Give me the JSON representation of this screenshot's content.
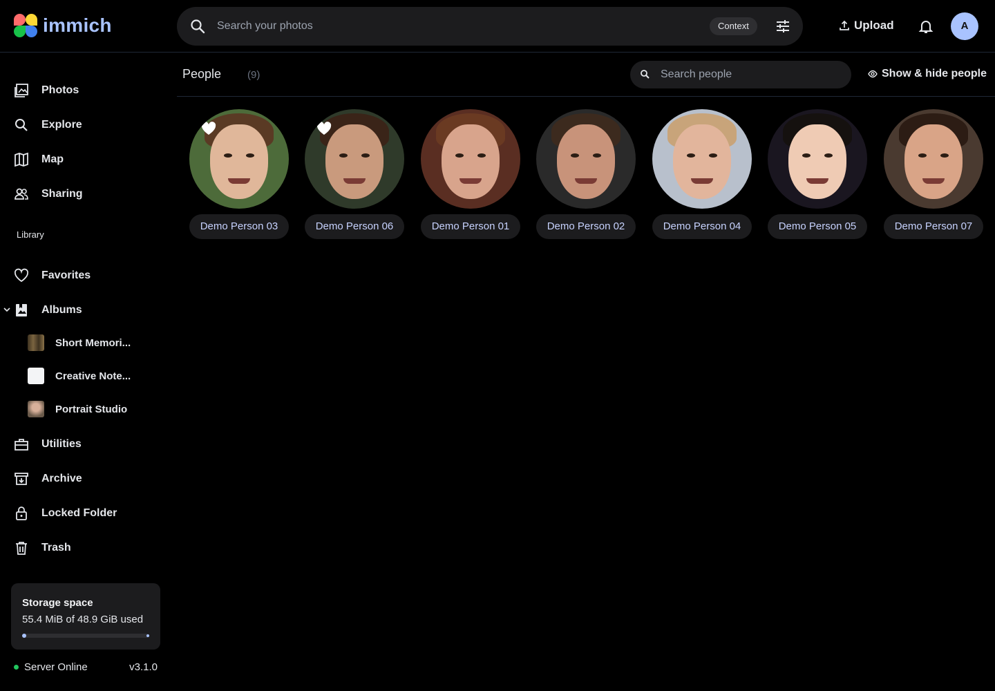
{
  "app": {
    "name": "immich"
  },
  "search": {
    "placeholder": "Search your photos",
    "context_label": "Context"
  },
  "header": {
    "upload_label": "Upload",
    "avatar_initial": "A"
  },
  "sidebar": {
    "nav": [
      {
        "label": "Photos",
        "icon": "photos-icon"
      },
      {
        "label": "Explore",
        "icon": "search-icon"
      },
      {
        "label": "Map",
        "icon": "map-icon"
      },
      {
        "label": "Sharing",
        "icon": "people-icon"
      }
    ],
    "library_label": "Library",
    "library": [
      {
        "label": "Favorites",
        "icon": "heart-icon"
      },
      {
        "label": "Albums",
        "icon": "album-icon"
      }
    ],
    "albums": [
      {
        "label": "Short Memori...",
        "thumb_color": "#6b5a3a"
      },
      {
        "label": "Creative Note...",
        "thumb_color": "#f3f4f6"
      },
      {
        "label": "Portrait Studio",
        "thumb_color": "#9a8a7a"
      }
    ],
    "more": [
      {
        "label": "Utilities",
        "icon": "toolbox-icon"
      },
      {
        "label": "Archive",
        "icon": "archive-icon"
      },
      {
        "label": "Locked Folder",
        "icon": "lock-icon"
      },
      {
        "label": "Trash",
        "icon": "trash-icon"
      }
    ],
    "storage": {
      "title": "Storage space",
      "used_text": "55.4 MiB of 48.9 GiB used",
      "used_fraction": 0.0011
    },
    "server": {
      "status": "Server Online",
      "version": "v3.1.0"
    }
  },
  "people_page": {
    "title": "People",
    "count": "(9)",
    "search_placeholder": "Search people",
    "show_hide_label": "Show & hide people",
    "people": [
      {
        "name": "Demo Person 03",
        "favorite": true,
        "bg": "#4d6b3a",
        "skin": "#e0b79a",
        "hair": "#5a3a24"
      },
      {
        "name": "Demo Person 06",
        "favorite": true,
        "bg": "#2f3a2a",
        "skin": "#c99a7d",
        "hair": "#3a2418"
      },
      {
        "name": "Demo Person 01",
        "favorite": false,
        "bg": "#5a2e22",
        "skin": "#d8a48c",
        "hair": "#6a3a22"
      },
      {
        "name": "Demo Person 02",
        "favorite": false,
        "bg": "#2a2a2a",
        "skin": "#c8937a",
        "hair": "#3c2a1e"
      },
      {
        "name": "Demo Person 04",
        "favorite": false,
        "bg": "#b8c0cc",
        "skin": "#e2b59c",
        "hair": "#c8a47a"
      },
      {
        "name": "Demo Person 05",
        "favorite": false,
        "bg": "#1a1620",
        "skin": "#efcbb4",
        "hair": "#15110f"
      },
      {
        "name": "Demo Person 07",
        "favorite": false,
        "bg": "#4a3a30",
        "skin": "#d9a487",
        "hair": "#2c1c14"
      }
    ]
  }
}
